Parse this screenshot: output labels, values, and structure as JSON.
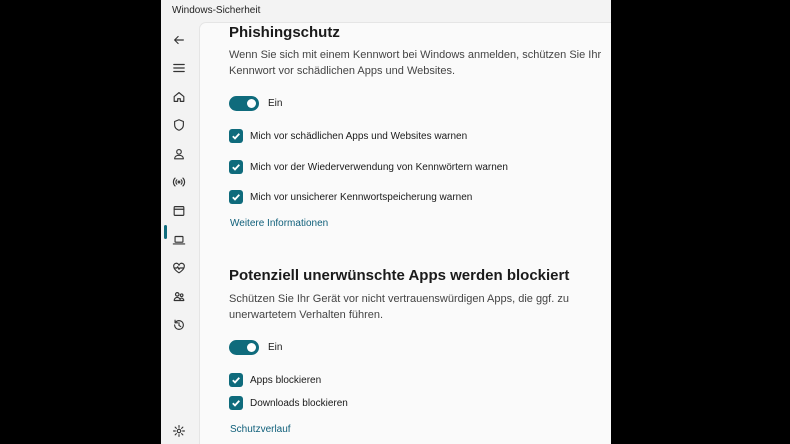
{
  "window": {
    "title": "Windows-Sicherheit"
  },
  "nav": {
    "items": [
      {
        "icon": "back-arrow-icon"
      },
      {
        "icon": "hamburger-menu-icon"
      },
      {
        "icon": "home-icon"
      },
      {
        "icon": "shield-icon"
      },
      {
        "icon": "person-icon"
      },
      {
        "icon": "wireless-icon"
      },
      {
        "icon": "app-browser-icon",
        "selected": true
      },
      {
        "icon": "laptop-icon"
      },
      {
        "icon": "heart-pulse-icon"
      },
      {
        "icon": "family-icon"
      },
      {
        "icon": "history-icon"
      },
      {
        "icon": "gear-icon"
      }
    ]
  },
  "phishing": {
    "heading": "Phishingschutz",
    "description": "Wenn Sie sich mit einem Kennwort bei Windows anmelden, schützen Sie Ihr Kennwort vor schädlichen Apps und Websites.",
    "toggle_label": "Ein",
    "toggle_on": true,
    "checkboxes": [
      {
        "label": "Mich vor schädlichen Apps und Websites warnen",
        "checked": true
      },
      {
        "label": "Mich vor der Wiederverwendung von Kennwörtern warnen",
        "checked": true
      },
      {
        "label": "Mich vor unsicherer Kennwortspeicherung warnen",
        "checked": true
      }
    ],
    "link": "Weitere Informationen"
  },
  "pua": {
    "heading": "Potenziell unerwünschte Apps werden blockiert",
    "description": "Schützen Sie Ihr Gerät vor nicht vertrauenswürdigen Apps, die ggf. zu unerwartetem Verhalten führen.",
    "toggle_label": "Ein",
    "toggle_on": true,
    "checkboxes": [
      {
        "label": "Apps blockieren",
        "checked": true
      },
      {
        "label": "Downloads blockieren",
        "checked": true
      }
    ],
    "link": "Schutzverlauf"
  },
  "colors": {
    "accent": "#0f6b7c",
    "link": "#0f5f7a"
  }
}
